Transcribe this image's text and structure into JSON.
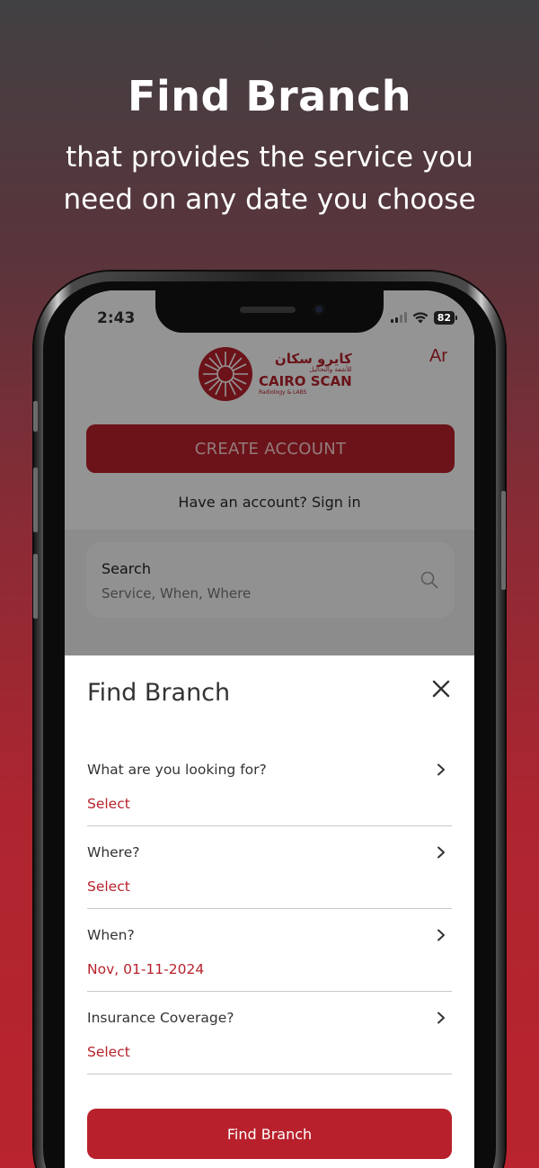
{
  "headline": "Find Branch",
  "subline": "that provides the service you need on any date you choose",
  "status": {
    "time": "2:43",
    "battery": "82"
  },
  "app": {
    "logo_ar": "كايرو سكان",
    "logo_ar_sub": "للأشعة والتحاليل",
    "logo_en": "CAIRO SCAN",
    "logo_en_sub": "Radiology & LABS",
    "lang": "Ar",
    "create_account": "CREATE ACCOUNT",
    "signin": "Have an account? Sign in",
    "search": {
      "title": "Search",
      "hint": "Service, When, Where"
    }
  },
  "sheet": {
    "title": "Find Branch",
    "fields": [
      {
        "label": "What are you looking for?",
        "value": "Select"
      },
      {
        "label": "Where?",
        "value": "Select"
      },
      {
        "label": "When?",
        "value": "Nov, 01-11-2024"
      },
      {
        "label": "Insurance Coverage?",
        "value": "Select"
      }
    ],
    "button": "Find Branch"
  },
  "colors": {
    "brand": "#b8212c",
    "accent_text": "#b7222c"
  },
  "icons": [
    "search-icon",
    "close-icon",
    "chevron-right-icon",
    "wifi-icon",
    "signal-icon",
    "battery-icon"
  ]
}
